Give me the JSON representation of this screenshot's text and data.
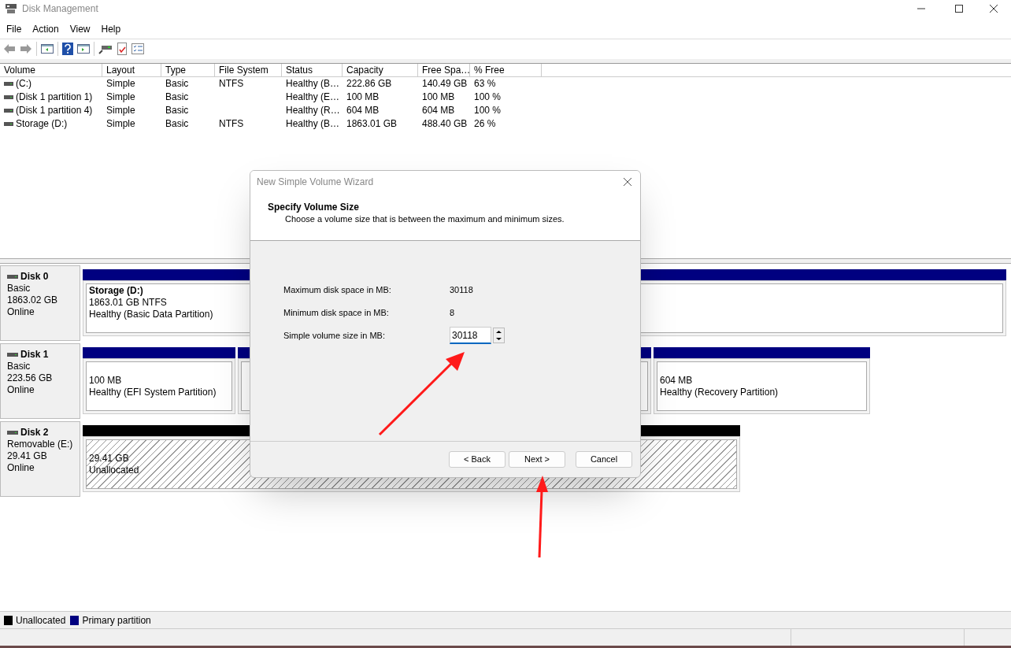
{
  "window": {
    "title": "Disk Management"
  },
  "menu": [
    "File",
    "Action",
    "View",
    "Help"
  ],
  "volumes": {
    "columns": [
      "Volume",
      "Layout",
      "Type",
      "File System",
      "Status",
      "Capacity",
      "Free Spa…",
      "% Free"
    ],
    "rows": [
      [
        "(C:)",
        "Simple",
        "Basic",
        "NTFS",
        "Healthy (B…",
        "222.86 GB",
        "140.49 GB",
        "63 %"
      ],
      [
        "(Disk 1 partition 1)",
        "Simple",
        "Basic",
        "",
        "Healthy (E…",
        "100 MB",
        "100 MB",
        "100 %"
      ],
      [
        "(Disk 1 partition 4)",
        "Simple",
        "Basic",
        "",
        "Healthy (R…",
        "604 MB",
        "604 MB",
        "100 %"
      ],
      [
        "Storage (D:)",
        "Simple",
        "Basic",
        "NTFS",
        "Healthy (B…",
        "1863.01 GB",
        "488.40 GB",
        "26 %"
      ]
    ]
  },
  "disks": [
    {
      "name": "Disk 0",
      "lines": [
        "Basic",
        "1863.02 GB",
        "Online"
      ],
      "partitions": [
        {
          "kind": "primary",
          "title": "Storage  (D:)",
          "lines": [
            "1863.01 GB NTFS",
            "Healthy (Basic Data Partition)"
          ]
        }
      ]
    },
    {
      "name": "Disk 1",
      "lines": [
        "Basic",
        "223.56 GB",
        "Online"
      ],
      "partitions": [
        {
          "kind": "primary",
          "lines": [
            "100 MB",
            "Healthy (EFI System Partition)"
          ]
        },
        {
          "kind": "primary"
        },
        {
          "kind": "primary",
          "lines": [
            "604 MB",
            "Healthy (Recovery Partition)"
          ]
        }
      ]
    },
    {
      "name": "Disk 2",
      "lines": [
        "Removable (E:)",
        "29.41 GB",
        "Online"
      ],
      "partitions": [
        {
          "kind": "unallocated",
          "lines": [
            "29.41 GB",
            "Unallocated"
          ]
        }
      ]
    }
  ],
  "legend": [
    {
      "label": "Unallocated",
      "color": "#000000"
    },
    {
      "label": "Primary partition",
      "color": "#000080"
    }
  ],
  "dialog": {
    "title": "New Simple Volume Wizard",
    "heading": "Specify Volume Size",
    "subheading": "Choose a volume size that is between the maximum and minimum sizes.",
    "fields": [
      {
        "label": "Maximum disk space in MB:",
        "value": "30118",
        "kind": "text"
      },
      {
        "label": "Minimum disk space in MB:",
        "value": "8",
        "kind": "text"
      },
      {
        "label": "Simple volume size in MB:",
        "value": "30118",
        "kind": "spin"
      }
    ],
    "buttons": [
      "< Back",
      "Next >",
      "Cancel"
    ]
  }
}
